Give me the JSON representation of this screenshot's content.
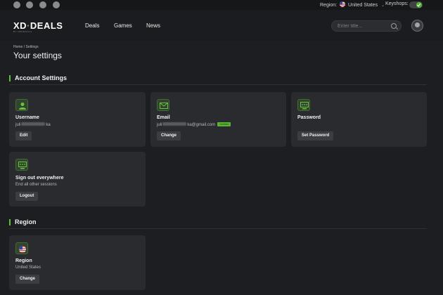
{
  "topbar": {
    "social_icons": [
      "facebook-icon",
      "instagram-icon",
      "youtube-icon",
      "discord-icon"
    ],
    "region_label": "Region:",
    "region_value": "United States",
    "keyshops_label": "Keyshops:",
    "keyshops_enabled": true
  },
  "navbar": {
    "logo_left": "XD",
    "logo_right": "DEALS",
    "logo_sub": "BY INDIEGALA",
    "links": [
      "Deals",
      "Games",
      "News"
    ],
    "search_placeholder": "Enter title..."
  },
  "breadcrumb": {
    "home": "Home",
    "separator": " / ",
    "current": "Settings"
  },
  "page_title": "Your settings",
  "account_section": {
    "title": "Account Settings",
    "cards": {
      "username": {
        "title": "Username",
        "value_start": "juli",
        "value_end": "ka",
        "button": "Edit"
      },
      "email": {
        "title": "Email",
        "value_start": "juli",
        "value_end": "ka@gmail.com",
        "badge": "Verified",
        "button": "Change"
      },
      "password": {
        "title": "Password",
        "button": "Set Password"
      },
      "signout": {
        "title": "Sign out everywhere",
        "subtitle": "End all other sessions",
        "button": "Logout"
      }
    }
  },
  "region_section": {
    "title": "Region",
    "card": {
      "title": "Region",
      "value": "United States",
      "button": "Change"
    }
  },
  "colors": {
    "accent": "#5fbf3c",
    "background": "#1d1e21",
    "card": "#2a2b2f",
    "button": "#3c3d41"
  }
}
